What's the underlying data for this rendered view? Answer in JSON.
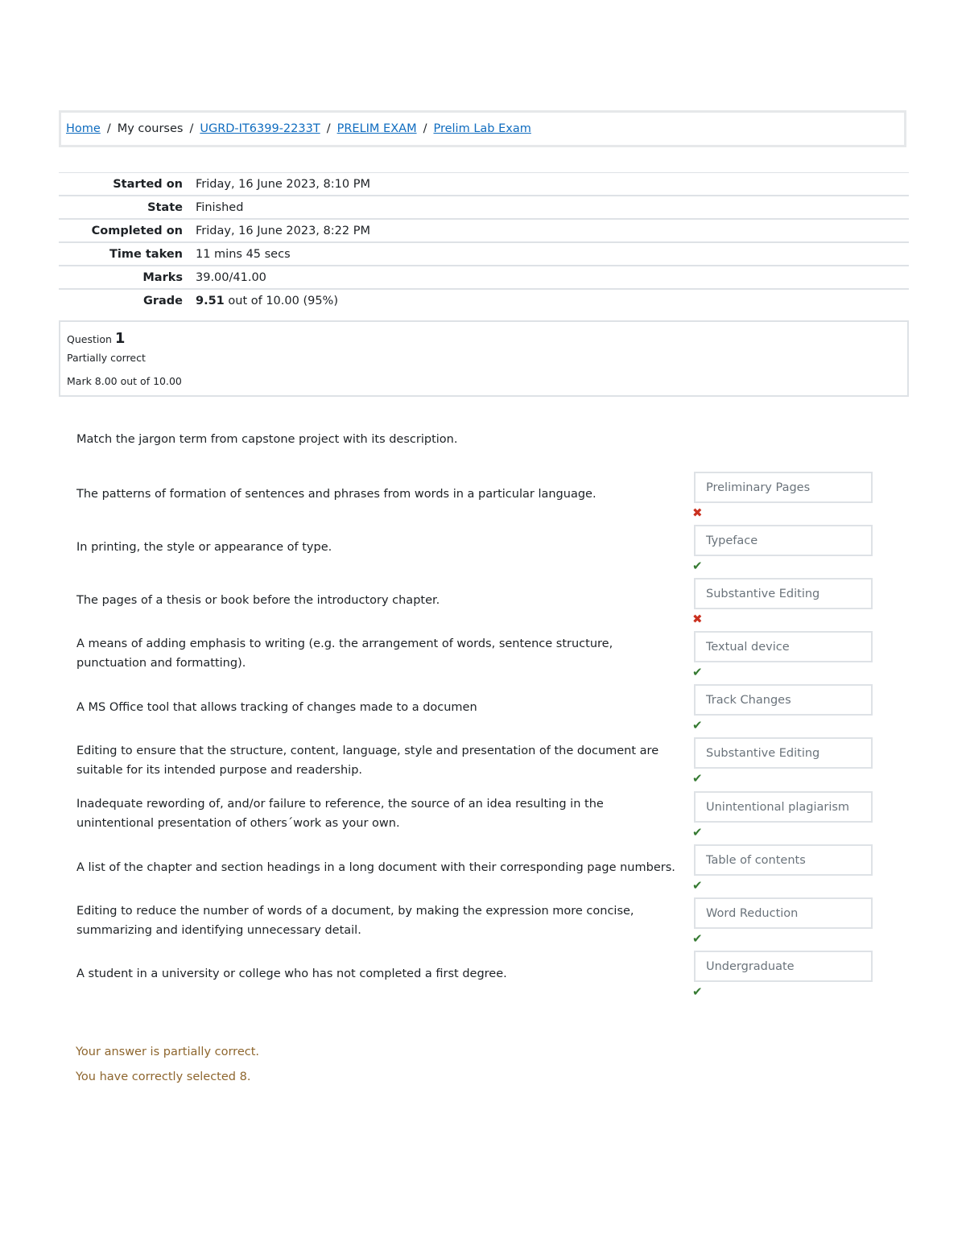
{
  "breadcrumb": {
    "items": [
      {
        "label": "Home",
        "link": true
      },
      {
        "label": "My courses",
        "link": false
      },
      {
        "label": "UGRD-IT6399-2233T",
        "link": true
      },
      {
        "label": "PRELIM EXAM",
        "link": true
      },
      {
        "label": "Prelim Lab Exam",
        "link": true
      }
    ],
    "separator": "/"
  },
  "summary": {
    "rows": [
      {
        "label": "Started on",
        "value": "Friday, 16 June 2023, 8:10 PM"
      },
      {
        "label": "State",
        "value": "Finished"
      },
      {
        "label": "Completed on",
        "value": "Friday, 16 June 2023, 8:22 PM"
      },
      {
        "label": "Time taken",
        "value": "11 mins 45 secs"
      },
      {
        "label": "Marks",
        "value": "39.00/41.00"
      },
      {
        "label": "Grade",
        "value_bold": "9.51",
        "value": " out of 10.00 (95%)"
      }
    ]
  },
  "question": {
    "label": "Question",
    "number": "1",
    "state": "Partially correct",
    "grade": "Mark 8.00 out of 10.00",
    "prompt": "Match the jargon term from capstone project with its description.",
    "items": [
      {
        "text": "The patterns of formation of sentences and phrases from words in a particular language.",
        "answer": "Preliminary Pages",
        "correct": false
      },
      {
        "text": "In printing, the style or appearance of type.",
        "answer": "Typeface",
        "correct": true
      },
      {
        "text": "The pages of a thesis or book before the introductory chapter.",
        "answer": "Substantive Editing",
        "correct": false
      },
      {
        "text": "A means of adding emphasis to writing (e.g. the arrangement of words, sentence structure, punctuation and formatting).",
        "answer": "Textual device",
        "correct": true
      },
      {
        "text": "A MS Office tool that allows tracking of changes made to a documen",
        "answer": "Track Changes",
        "correct": true
      },
      {
        "text": "Editing to ensure that the structure, content, language, style and presentation of the document are suitable for its intended purpose and readership.",
        "answer": "Substantive Editing",
        "correct": true
      },
      {
        "text": "Inadequate rewording of, and/or failure to reference, the source of an idea resulting in the unintentional presentation of others´work as your own.",
        "answer": "Unintentional plagiarism",
        "correct": true
      },
      {
        "text": "A list of the chapter and section headings in a long document with their corresponding page numbers.",
        "answer": "Table of contents",
        "correct": true
      },
      {
        "text": "Editing to reduce the number of words of a document, by making the expression more concise, summarizing and identifying unnecessary detail.",
        "answer": "Word Reduction",
        "correct": true
      },
      {
        "text": "A student in a university or college who has not completed a first degree.",
        "answer": "Undergraduate",
        "correct": true
      }
    ],
    "icons": {
      "correct": "✔",
      "incorrect": "✖"
    },
    "feedback": {
      "line1": "Your answer is partially correct.",
      "line2": "You have correctly selected 8."
    }
  },
  "colors": {
    "link": "#0f6cbf",
    "correct": "#357a32",
    "incorrect": "#ca3120",
    "feedback": "#8e662e"
  }
}
